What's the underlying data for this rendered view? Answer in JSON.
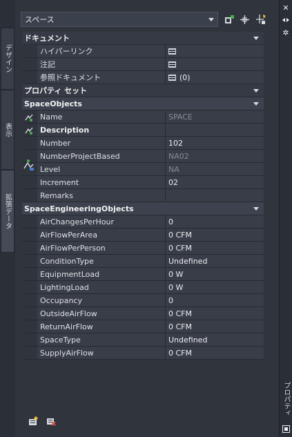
{
  "left_tabs": [
    "デザイン",
    "表示",
    "拡張データ"
  ],
  "right_strip": {
    "label": "プロパティ"
  },
  "top": {
    "selected": "スペース"
  },
  "sections": {
    "document": {
      "title": "ドキュメント",
      "rows": [
        {
          "name": "ハイパーリンク",
          "value": ""
        },
        {
          "name": "注記",
          "value": ""
        },
        {
          "name": "参照ドキュメント",
          "value": "(0)"
        }
      ]
    },
    "property_sets": {
      "title": "プロパティ セット"
    },
    "space_objects": {
      "title": "SpaceObjects",
      "rows": [
        {
          "name": "Name",
          "value": "SPACE"
        },
        {
          "name": "Description",
          "value": ""
        },
        {
          "name": "Number",
          "value": "102"
        },
        {
          "name": "NumberProjectBased",
          "value": "NA02"
        },
        {
          "name": "Level",
          "value": "NA"
        },
        {
          "name": "Increment",
          "value": "02"
        },
        {
          "name": "Remarks",
          "value": ""
        }
      ]
    },
    "space_engineering": {
      "title": "SpaceEngineeringObjects",
      "rows": [
        {
          "name": "AirChangesPerHour",
          "value": "0"
        },
        {
          "name": "AirFlowPerArea",
          "value": "0 CFM"
        },
        {
          "name": "AirFlowPerPerson",
          "value": "0 CFM"
        },
        {
          "name": "ConditionType",
          "value": "Undefined"
        },
        {
          "name": "EquipmentLoad",
          "value": "0 W"
        },
        {
          "name": "LightingLoad",
          "value": "0 W"
        },
        {
          "name": "Occupancy",
          "value": "0"
        },
        {
          "name": "OutsideAirFlow",
          "value": "0 CFM"
        },
        {
          "name": "ReturnAirFlow",
          "value": "0 CFM"
        },
        {
          "name": "SpaceType",
          "value": "Undefined"
        },
        {
          "name": "SupplyAirFlow",
          "value": "0 CFM"
        }
      ]
    }
  },
  "colors": {
    "panel": "#2f343d",
    "row": "#383d47",
    "accent_green": "#4caf50",
    "accent_red": "#d9534f"
  }
}
